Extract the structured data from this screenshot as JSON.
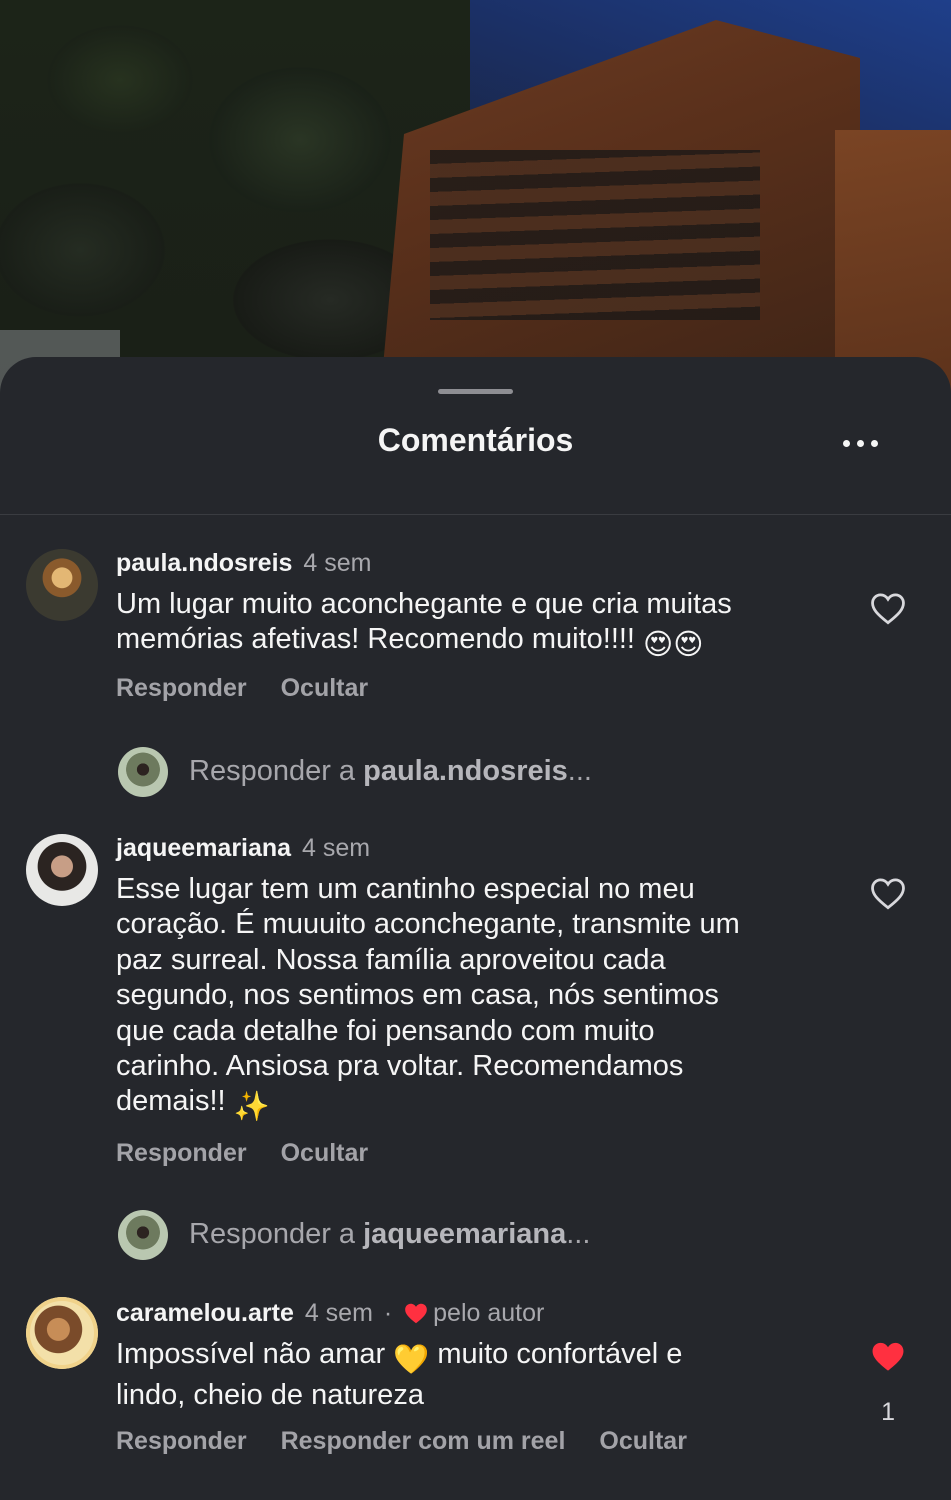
{
  "sheet": {
    "title": "Comentários",
    "more_icon": "more-horizontal-icon"
  },
  "comments": [
    {
      "username": "paula.ndosreis",
      "time": "4 sem",
      "text_line1": "Um lugar muito aconchegante e que cria muitas",
      "text_line2": "memórias afetivas! Recomendo muito!!!! ",
      "emoji": "😍😍",
      "reply_label": "Responder",
      "hide_label": "Ocultar",
      "liked": false,
      "reply_prompt_prefix": "Responder a ",
      "reply_prompt_target": "paula.ndosreis",
      "reply_prompt_suffix": "..."
    },
    {
      "username": "jaqueemariana",
      "time": "4 sem",
      "lines": [
        "Esse lugar tem um cantinho especial no meu",
        "coração. É muuuito aconchegante, transmite um",
        "paz surreal. Nossa família aproveitou cada",
        "segundo, nos sentimos em casa, nós sentimos",
        "que cada detalhe foi pensando com muito",
        "carinho. Ansiosa pra voltar. Recomendamos",
        "demais!! "
      ],
      "emoji": "✨",
      "reply_label": "Responder",
      "hide_label": "Ocultar",
      "liked": false,
      "reply_prompt_prefix": "Responder a ",
      "reply_prompt_target": "jaqueemariana",
      "reply_prompt_suffix": "..."
    },
    {
      "username": "caramelou.arte",
      "time": "4 sem",
      "separator": "·",
      "author_badge": "pelo autor",
      "text_line1_a": "Impossível não amar ",
      "emoji": "💛",
      "text_line1_b": " muito confortável e",
      "text_line2": "lindo, cheio de natureza",
      "reply_label": "Responder",
      "reel_label": "Responder com um reel",
      "hide_label": "Ocultar",
      "liked": true,
      "like_count": "1"
    }
  ],
  "colors": {
    "sheet_bg": "#25272c",
    "text": "#f5f5f5",
    "muted": "#a8a8ad",
    "like_red": "#ff3040"
  }
}
